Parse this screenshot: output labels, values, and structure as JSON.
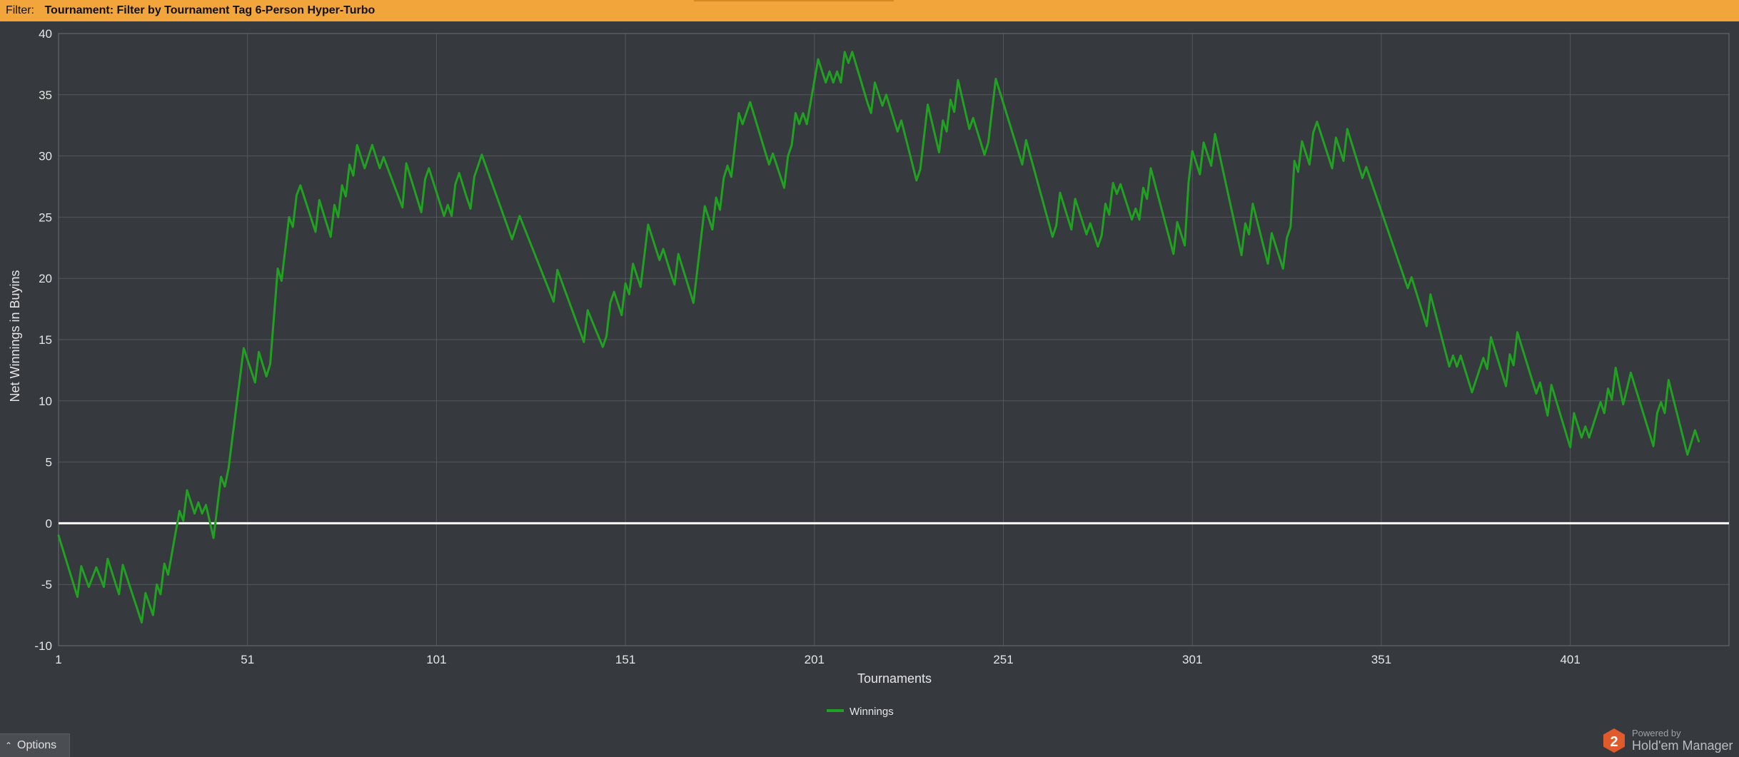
{
  "filter": {
    "label": "Filter:",
    "value": "Tournament: Filter by Tournament Tag  6-Person Hyper-Turbo"
  },
  "options": {
    "label": "Options",
    "icon": "chevron-up-icon"
  },
  "brand": {
    "powered_by": "Powered by",
    "name": "Hold'em Manager",
    "logo_digit": "2",
    "logo_color": "#e05a2b"
  },
  "colors": {
    "series": "#21a121",
    "zero_line": "#ffffff",
    "grid": "#54575c",
    "background": "#36393d",
    "filter_bar": "#f2a53b"
  },
  "chart_data": {
    "type": "line",
    "xlabel": "Tournaments",
    "ylabel": "Net Winnings in Buyins",
    "xlim": [
      1,
      443
    ],
    "ylim": [
      -10,
      40
    ],
    "x_ticks": [
      1,
      51,
      101,
      151,
      201,
      251,
      301,
      351,
      401
    ],
    "y_ticks": [
      40,
      35,
      30,
      25,
      20,
      15,
      10,
      5,
      0,
      -5,
      -10
    ],
    "grid": true,
    "legend_position": "bottom-center",
    "series": [
      {
        "name": "Winnings",
        "color": "#21a121",
        "points": [
          [
            1,
            -1
          ],
          [
            6,
            -6
          ],
          [
            7,
            -3.5
          ],
          [
            9,
            -5.2
          ],
          [
            11,
            -3.6
          ],
          [
            13,
            -5.2
          ],
          [
            14,
            -2.9
          ],
          [
            17,
            -5.8
          ],
          [
            18,
            -3.4
          ],
          [
            23,
            -8.1
          ],
          [
            24,
            -5.7
          ],
          [
            26,
            -7.5
          ],
          [
            27,
            -5
          ],
          [
            28,
            -5.8
          ],
          [
            29,
            -3.3
          ],
          [
            30,
            -4.2
          ],
          [
            33,
            1
          ],
          [
            34,
            0.2
          ],
          [
            35,
            2.7
          ],
          [
            37,
            0.8
          ],
          [
            38,
            1.7
          ],
          [
            39,
            0.8
          ],
          [
            40,
            1.5
          ],
          [
            42,
            -1.2
          ],
          [
            44,
            3.8
          ],
          [
            45,
            3
          ],
          [
            46,
            4.5
          ],
          [
            50,
            14.3
          ],
          [
            53,
            11.5
          ],
          [
            54,
            14
          ],
          [
            56,
            12
          ],
          [
            57,
            13
          ],
          [
            59,
            20.8
          ],
          [
            60,
            19.8
          ],
          [
            62,
            25
          ],
          [
            63,
            24.2
          ],
          [
            64,
            26.8
          ],
          [
            65,
            27.6
          ],
          [
            69,
            23.8
          ],
          [
            70,
            26.4
          ],
          [
            73,
            23.4
          ],
          [
            74,
            26
          ],
          [
            75,
            25
          ],
          [
            76,
            27.6
          ],
          [
            77,
            26.7
          ],
          [
            78,
            29.3
          ],
          [
            79,
            28.4
          ],
          [
            80,
            30.9
          ],
          [
            82,
            29
          ],
          [
            84,
            30.9
          ],
          [
            86,
            29
          ],
          [
            87,
            29.9
          ],
          [
            92,
            25.8
          ],
          [
            93,
            29.4
          ],
          [
            97,
            25.4
          ],
          [
            98,
            28.1
          ],
          [
            99,
            29
          ],
          [
            103,
            25.1
          ],
          [
            104,
            26
          ],
          [
            105,
            25.1
          ],
          [
            106,
            27.7
          ],
          [
            107,
            28.6
          ],
          [
            109,
            26.6
          ],
          [
            110,
            25.7
          ],
          [
            111,
            28.3
          ],
          [
            113,
            30.1
          ],
          [
            121,
            23.2
          ],
          [
            123,
            25.1
          ],
          [
            132,
            18.1
          ],
          [
            133,
            20.7
          ],
          [
            140,
            14.8
          ],
          [
            141,
            17.4
          ],
          [
            145,
            14.4
          ],
          [
            146,
            15.3
          ],
          [
            147,
            18
          ],
          [
            148,
            18.9
          ],
          [
            150,
            17
          ],
          [
            151,
            19.6
          ],
          [
            152,
            18.7
          ],
          [
            153,
            21.2
          ],
          [
            155,
            19.3
          ],
          [
            157,
            24.4
          ],
          [
            160,
            21.5
          ],
          [
            161,
            22.4
          ],
          [
            163,
            20.4
          ],
          [
            164,
            19.5
          ],
          [
            165,
            22
          ],
          [
            169,
            18
          ],
          [
            172,
            25.9
          ],
          [
            174,
            24
          ],
          [
            175,
            26.6
          ],
          [
            176,
            25.6
          ],
          [
            177,
            28.2
          ],
          [
            178,
            29.2
          ],
          [
            179,
            28.3
          ],
          [
            180,
            30.9
          ],
          [
            181,
            33.5
          ],
          [
            182,
            32.6
          ],
          [
            184,
            34.4
          ],
          [
            189,
            29.3
          ],
          [
            190,
            30.2
          ],
          [
            193,
            27.4
          ],
          [
            194,
            30
          ],
          [
            195,
            30.9
          ],
          [
            196,
            33.5
          ],
          [
            197,
            32.6
          ],
          [
            198,
            33.5
          ],
          [
            199,
            32.6
          ],
          [
            202,
            37.9
          ],
          [
            204,
            36
          ],
          [
            205,
            36.9
          ],
          [
            206,
            36
          ],
          [
            207,
            36.9
          ],
          [
            208,
            36
          ],
          [
            209,
            38.5
          ],
          [
            210,
            37.6
          ],
          [
            211,
            38.5
          ],
          [
            215,
            34.4
          ],
          [
            216,
            33.5
          ],
          [
            217,
            36
          ],
          [
            219,
            34.1
          ],
          [
            220,
            35
          ],
          [
            223,
            32
          ],
          [
            224,
            32.9
          ],
          [
            228,
            28
          ],
          [
            229,
            28.9
          ],
          [
            231,
            34.2
          ],
          [
            234,
            30.3
          ],
          [
            235,
            32.9
          ],
          [
            236,
            32
          ],
          [
            237,
            34.6
          ],
          [
            238,
            33.6
          ],
          [
            239,
            36.2
          ],
          [
            242,
            32.2
          ],
          [
            243,
            33.1
          ],
          [
            246,
            30.1
          ],
          [
            247,
            31.1
          ],
          [
            249,
            36.3
          ],
          [
            256,
            29.3
          ],
          [
            257,
            31.3
          ],
          [
            264,
            23.4
          ],
          [
            265,
            24.3
          ],
          [
            266,
            27
          ],
          [
            269,
            24
          ],
          [
            270,
            26.5
          ],
          [
            273,
            23.6
          ],
          [
            274,
            24.5
          ],
          [
            276,
            22.6
          ],
          [
            277,
            23.5
          ],
          [
            278,
            26.1
          ],
          [
            279,
            25.2
          ],
          [
            280,
            27.8
          ],
          [
            281,
            26.9
          ],
          [
            282,
            27.7
          ],
          [
            285,
            24.8
          ],
          [
            286,
            25.7
          ],
          [
            287,
            24.8
          ],
          [
            288,
            27.4
          ],
          [
            289,
            26.5
          ],
          [
            290,
            29
          ],
          [
            296,
            22
          ],
          [
            297,
            24.6
          ],
          [
            299,
            22.7
          ],
          [
            300,
            27.8
          ],
          [
            301,
            30.4
          ],
          [
            303,
            28.5
          ],
          [
            304,
            31.1
          ],
          [
            306,
            29.2
          ],
          [
            307,
            31.8
          ],
          [
            314,
            21.9
          ],
          [
            315,
            24.5
          ],
          [
            316,
            23.6
          ],
          [
            317,
            26.1
          ],
          [
            321,
            21.2
          ],
          [
            322,
            23.7
          ],
          [
            325,
            20.8
          ],
          [
            326,
            23.3
          ],
          [
            327,
            24.2
          ],
          [
            328,
            29.6
          ],
          [
            329,
            28.7
          ],
          [
            330,
            31.2
          ],
          [
            332,
            29.3
          ],
          [
            333,
            31.9
          ],
          [
            334,
            32.8
          ],
          [
            338,
            29
          ],
          [
            339,
            31.5
          ],
          [
            341,
            29.6
          ],
          [
            342,
            32.2
          ],
          [
            346,
            28.2
          ],
          [
            347,
            29.1
          ],
          [
            358,
            19.2
          ],
          [
            359,
            20.1
          ],
          [
            363,
            16.1
          ],
          [
            364,
            18.7
          ],
          [
            369,
            12.8
          ],
          [
            370,
            13.7
          ],
          [
            371,
            12.8
          ],
          [
            372,
            13.7
          ],
          [
            375,
            10.7
          ],
          [
            378,
            13.5
          ],
          [
            379,
            12.6
          ],
          [
            380,
            15.2
          ],
          [
            384,
            11.2
          ],
          [
            385,
            13.8
          ],
          [
            386,
            12.9
          ],
          [
            387,
            15.6
          ],
          [
            392,
            10.6
          ],
          [
            393,
            11.5
          ],
          [
            395,
            8.8
          ],
          [
            396,
            11.3
          ],
          [
            401,
            6.2
          ],
          [
            402,
            9
          ],
          [
            404,
            7
          ],
          [
            405,
            7.9
          ],
          [
            406,
            7
          ],
          [
            409,
            9.9
          ],
          [
            410,
            9
          ],
          [
            411,
            11
          ],
          [
            412,
            10.1
          ],
          [
            413,
            12.7
          ],
          [
            415,
            9.7
          ],
          [
            417,
            12.3
          ],
          [
            423,
            6.3
          ],
          [
            424,
            9
          ],
          [
            425,
            9.9
          ],
          [
            426,
            9
          ],
          [
            427,
            11.7
          ],
          [
            432,
            5.6
          ],
          [
            434,
            7.6
          ],
          [
            435,
            6.7
          ]
        ]
      }
    ]
  }
}
